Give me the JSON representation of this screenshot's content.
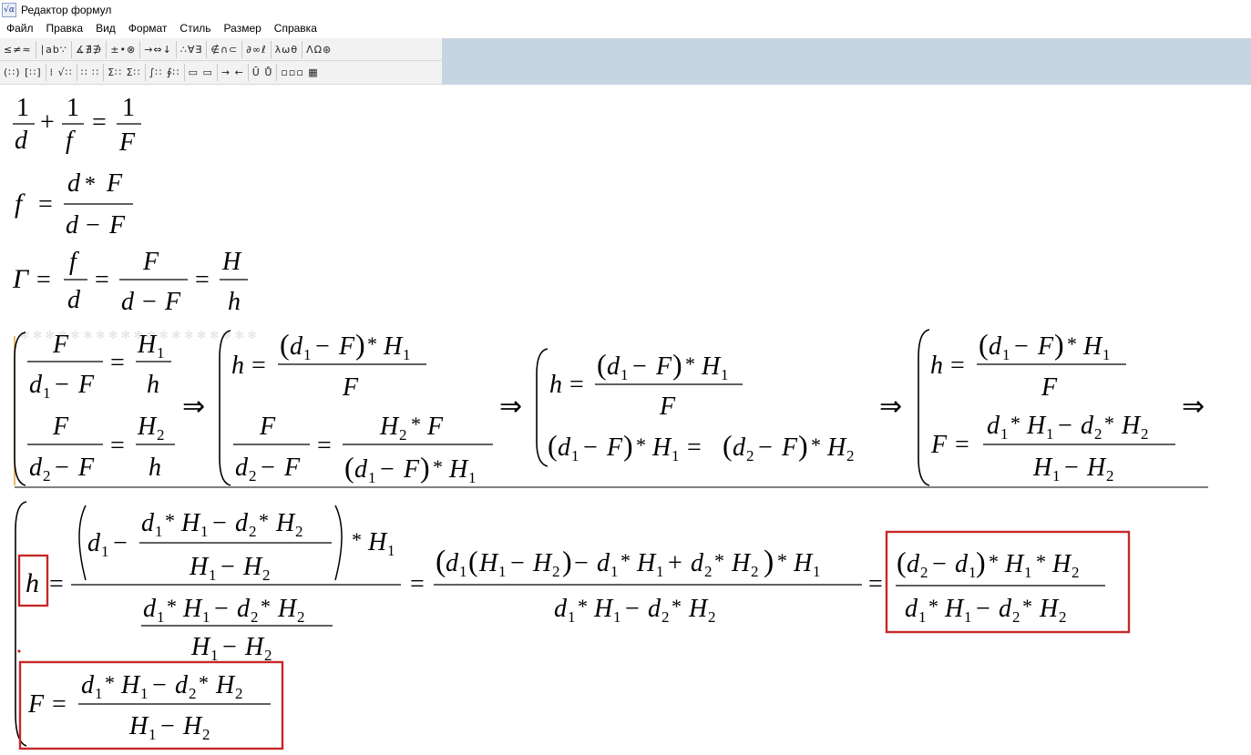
{
  "window": {
    "title": "Редактор формул",
    "icon": "formula-editor-icon"
  },
  "menu": [
    "Файл",
    "Правка",
    "Вид",
    "Формат",
    "Стиль",
    "Размер",
    "Справка"
  ],
  "toolbar_row1": [
    "≤≠≈",
    "∣ab∵",
    "∡∄∌",
    "±•⊗",
    "→⇔↓",
    "∴∀∃",
    "∉∩⊂",
    "∂∞ℓ",
    "λωθ",
    "ΛΩ⊛"
  ],
  "toolbar_row2": [
    "(∷) [∷]",
    "⁞ √∷",
    "∷ ∷",
    "Σ∷ Σ∷",
    "∫∷ ∮∷",
    "▭ ▭",
    "→ ←",
    "Ū Ů",
    "▫▫▫ ▦"
  ],
  "colors": {
    "highlight": "#c62828",
    "toolbar_bg": "#f2f2f2",
    "toolbar_area": "#c7d4e2"
  },
  "formulas": {
    "lens_equation": "1/d + 1/f = 1/F",
    "image_distance": "f = d*F/(d − F)",
    "magnification": "Γ = f/d = F/(d − F) = H/h",
    "system_step1": [
      "F/(d1 − F) = H1/h",
      "F/(d2 − F) = H2/h"
    ],
    "system_step2": [
      "h = (d1 − F)*H1/F",
      "F/(d2 − F) = H2*F/((d1 − F)*H1)"
    ],
    "system_step3": [
      "h = (d1 − F)*H1/F",
      "(d1 − F)*H1 = (d2 − F)*H2"
    ],
    "system_step4": [
      "h = (d1 − F)*H1/F",
      "F = (d1*H1 − d2*H2)/(H1 − H2)"
    ],
    "final_h": "h = (d2 − d1)*H1*H2/(d1*H1 − d2*H2)",
    "final_F": "F = (d1*H1 − d2*H2)/(H1 − H2)"
  },
  "symbols": {
    "one": "1",
    "d": "d",
    "f": "f",
    "F": "F",
    "H": "H",
    "h": "h",
    "Gamma": "Γ",
    "plus": "+",
    "minus": "−",
    "eq": "=",
    "star": "*",
    "implies": "⇒",
    "lparen": "(",
    "rparen": ")",
    "s1": "1",
    "s2": "2"
  }
}
